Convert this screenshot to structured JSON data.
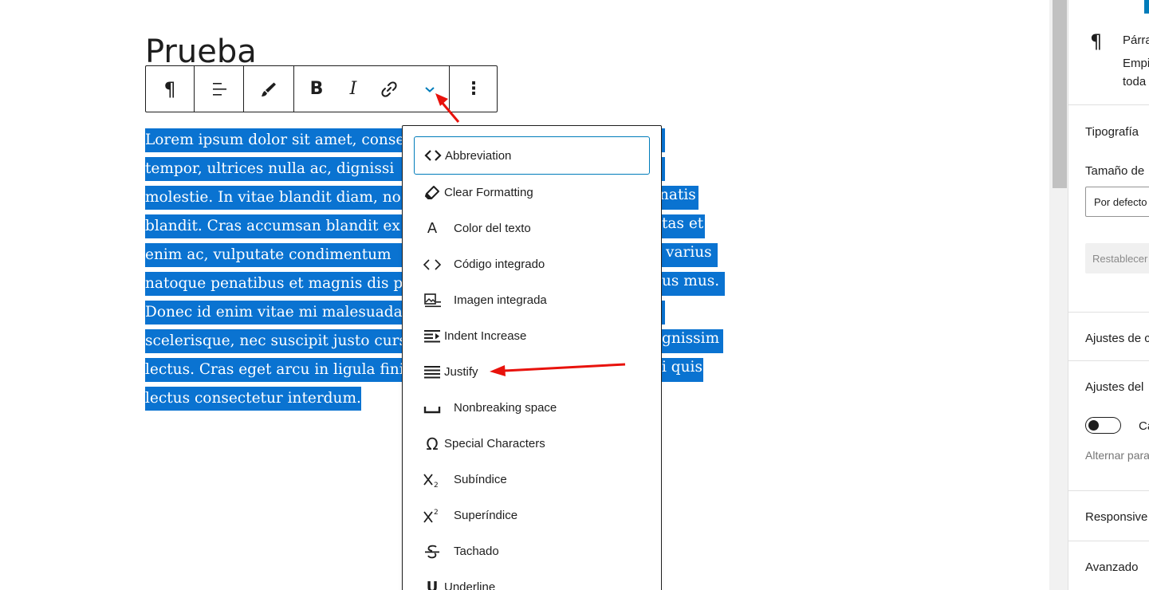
{
  "editor": {
    "post_title": "Prueba",
    "paragraph_lines": [
      "Lorem ipsum dolor sit amet, conse",
      "tempor, ultrices nulla ac, dignissi",
      "molestie. In vitae blandit diam, no",
      "blandit. Cras accumsan blandit ex",
      "enim ac, vulputate condimentum",
      "natoque penatibus et magnis dis p",
      "Donec id enim vitae mi malesuada",
      "scelerisque, nec suscipit justo curs",
      "lectus. Cras eget arcu in ligula fini",
      "lectus consectetur interdum."
    ],
    "paragraph_line_tails": [
      "",
      "",
      "natis",
      "tas et",
      "varius",
      "us mus.",
      "",
      "gnissim",
      "i quis",
      ""
    ],
    "selection_color": "#0a73d1"
  },
  "toolbar": {
    "paragraph_glyph": "¶",
    "bold_glyph": "B",
    "italic_glyph": "I",
    "more_glyph": "⋮"
  },
  "format_menu": {
    "items": [
      {
        "label": "Abbreviation",
        "icon": "code-brackets-icon"
      },
      {
        "label": "Clear Formatting",
        "icon": "eraser-icon"
      },
      {
        "label": "Color del texto",
        "icon": "text-color-icon",
        "glyph": "A"
      },
      {
        "label": "Código integrado",
        "icon": "inline-code-icon"
      },
      {
        "label": "Imagen integrada",
        "icon": "inline-image-icon"
      },
      {
        "label": "Indent Increase",
        "icon": "indent-increase-icon"
      },
      {
        "label": "Justify",
        "icon": "justify-icon"
      },
      {
        "label": "Nonbreaking space",
        "icon": "nonbreaking-space-icon"
      },
      {
        "label": "Special Characters",
        "icon": "omega-icon",
        "glyph": "Ω"
      },
      {
        "label": "Subíndice",
        "icon": "subscript-icon"
      },
      {
        "label": "Superíndice",
        "icon": "superscript-icon"
      },
      {
        "label": "Tachado",
        "icon": "strikethrough-icon"
      },
      {
        "label": "Underline",
        "icon": "underline-icon",
        "glyph": "U"
      }
    ],
    "focus_color": "#007cba"
  },
  "sidebar": {
    "block_title": "Párra",
    "block_desc_1": "Empi",
    "block_desc_2": "toda",
    "typography": "Tipografía",
    "font_size_label": "Tamaño de",
    "font_size_value": "Por defecto",
    "reset_button": "Restablecer",
    "panel_color": "Ajustes de c",
    "panel_text": "Ajustes del",
    "toggle_label": "Cap",
    "toggle_help": "Alternar para",
    "responsive": "Responsive",
    "advanced": "Avanzado",
    "paragraph_glyph": "¶"
  },
  "annotation_color": "#e8120c"
}
